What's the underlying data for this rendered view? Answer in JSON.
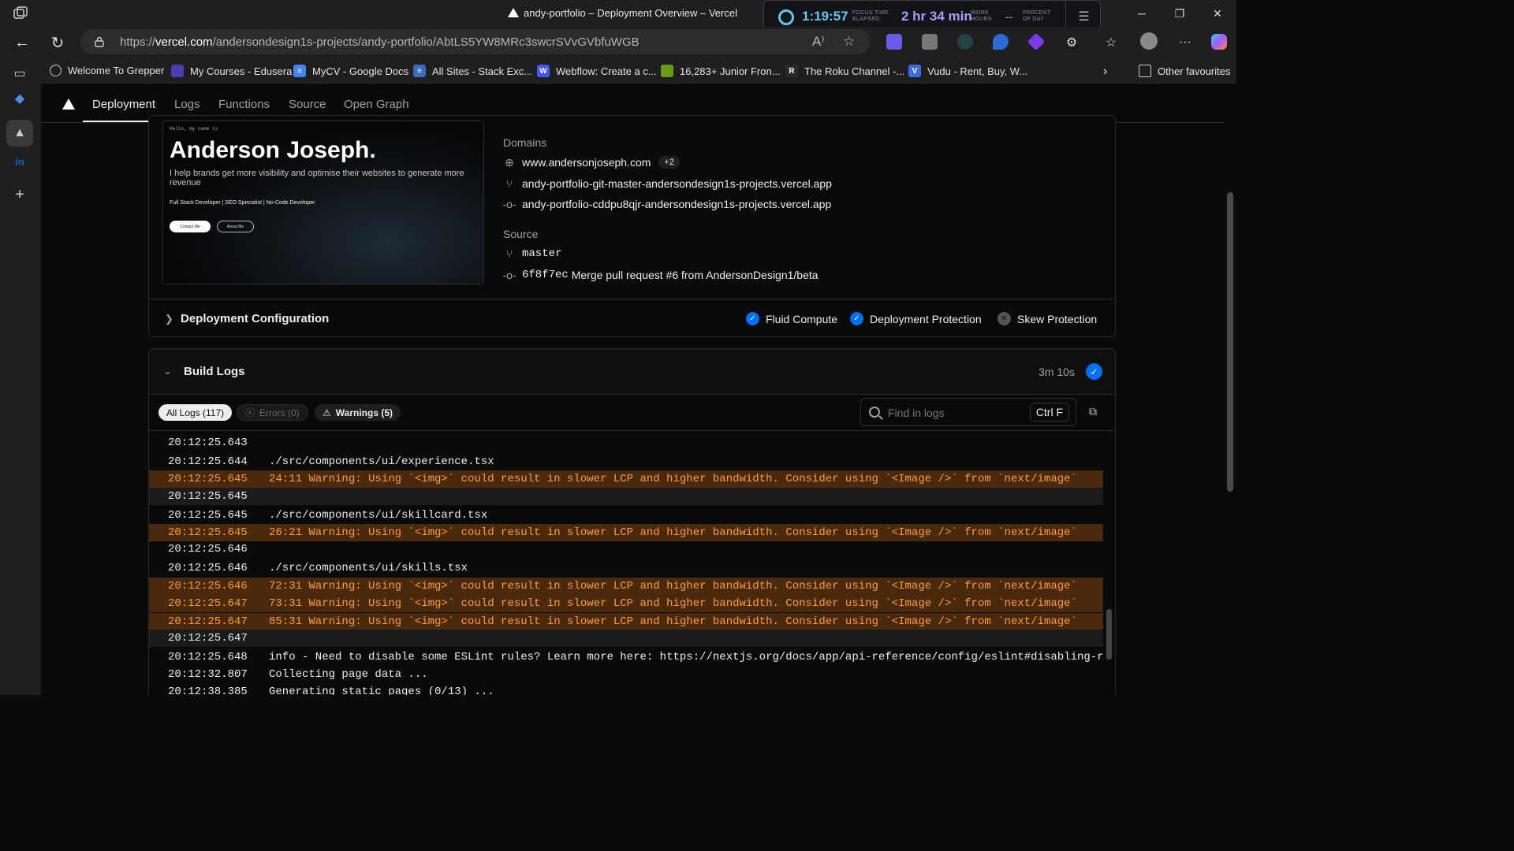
{
  "window": {
    "tab_title": "andy-portfolio – Deployment Overview – Vercel",
    "focus_timer": "1:19:57",
    "focus_label_1": "FOCUS TIME",
    "focus_label_2": "ELAPSED",
    "work_hours": "2 hr 34 min",
    "work_label_1": "WORK",
    "work_label_2": "HOURS",
    "percent_value": "--",
    "percent_label_1": "PERCENT",
    "percent_label_2": "OF DAY"
  },
  "addressbar": {
    "url_prefix": "https://",
    "url_host": "vercel.com",
    "url_path": "/andersondesign1s-projects/andy-portfolio/AbtLS5YW8MRc3swcrSVvGVbfuWGB"
  },
  "bookmarks": [
    {
      "label": "Welcome To Grepper",
      "icon": "globe-icon"
    },
    {
      "label": "My Courses - Edusera",
      "icon": "edusera-icon"
    },
    {
      "label": "MyCV - Google Docs",
      "icon": "google-docs-icon"
    },
    {
      "label": "All Sites - Stack Exc...",
      "icon": "stack-exchange-icon"
    },
    {
      "label": "Webflow: Create a c...",
      "icon": "webflow-icon"
    },
    {
      "label": "16,283+ Junior Fron...",
      "icon": "frontend-icon"
    },
    {
      "label": "The Roku Channel -...",
      "icon": "roku-icon"
    },
    {
      "label": "Vudu - Rent, Buy, W...",
      "icon": "vudu-icon"
    }
  ],
  "other_favourites": "Other favourites",
  "nav_tabs": [
    "Deployment",
    "Logs",
    "Functions",
    "Source",
    "Open Graph"
  ],
  "preview": {
    "hello": "Hello, my name is",
    "name": "Anderson Joseph.",
    "tagline": "I help brands get more visibility and optimise their websites to generate more revenue",
    "roles": "Full Stack Developer | SEO Specialist | No-Code Developer",
    "contact_btn": "Contact Me",
    "about_btn": "About Me"
  },
  "domains": {
    "label": "Domains",
    "primary": "www.andersonjoseph.com",
    "extra_count": "+2",
    "branch_url": "andy-portfolio-git-master-andersondesign1s-projects.vercel.app",
    "commit_url": "andy-portfolio-cddpu8qjr-andersondesign1s-projects.vercel.app"
  },
  "source": {
    "label": "Source",
    "branch": "master",
    "commit_sha": "6f8f7ec",
    "commit_message": "Merge pull request #6 from AndersonDesign1/beta"
  },
  "deployment_config": {
    "title": "Deployment Configuration",
    "features": [
      {
        "label": "Fluid Compute",
        "enabled": true
      },
      {
        "label": "Deployment Protection",
        "enabled": true
      },
      {
        "label": "Skew Protection",
        "enabled": false
      }
    ]
  },
  "build_logs": {
    "title": "Build Logs",
    "duration": "3m 10s",
    "filters": {
      "all": "All Logs (117)",
      "errors": "Errors (0)",
      "warnings": "Warnings (5)"
    },
    "search_placeholder": "Find in logs",
    "search_shortcut": "Ctrl F",
    "lines": [
      {
        "ts": "20:12:25.643",
        "msg": "",
        "kind": "plain"
      },
      {
        "ts": "20:12:25.644",
        "msg": "./src/components/ui/experience.tsx",
        "kind": "plain"
      },
      {
        "ts": "20:12:25.645",
        "msg": "24:11  Warning: Using `<img>` could result in slower LCP and higher bandwidth. Consider using `<Image />` from `next/image`",
        "kind": "warn"
      },
      {
        "ts": "20:12:25.645",
        "msg": "",
        "kind": "blank"
      },
      {
        "ts": "20:12:25.645",
        "msg": "./src/components/ui/skillcard.tsx",
        "kind": "plain"
      },
      {
        "ts": "20:12:25.645",
        "msg": "26:21  Warning: Using `<img>` could result in slower LCP and higher bandwidth. Consider using `<Image />` from `next/image`",
        "kind": "warn"
      },
      {
        "ts": "20:12:25.646",
        "msg": "",
        "kind": "plain"
      },
      {
        "ts": "20:12:25.646",
        "msg": "./src/components/ui/skills.tsx",
        "kind": "plain"
      },
      {
        "ts": "20:12:25.646",
        "msg": "72:31  Warning: Using `<img>` could result in slower LCP and higher bandwidth. Consider using `<Image />` from `next/image`",
        "kind": "warn"
      },
      {
        "ts": "20:12:25.647",
        "msg": "73:31  Warning: Using `<img>` could result in slower LCP and higher bandwidth. Consider using `<Image />` from `next/image`",
        "kind": "warn"
      },
      {
        "ts": "20:12:25.647",
        "msg": "85:31  Warning: Using `<img>` could result in slower LCP and higher bandwidth. Consider using `<Image />` from `next/image`",
        "kind": "warn"
      },
      {
        "ts": "20:12:25.647",
        "msg": "",
        "kind": "blank"
      },
      {
        "ts": "20:12:25.648",
        "msg": "info  - Need to disable some ESLint rules? Learn more here: https://nextjs.org/docs/app/api-reference/config/eslint#disabling-rules",
        "kind": "plain"
      },
      {
        "ts": "20:12:32.807",
        "msg": "   Collecting page data ...",
        "kind": "plain"
      },
      {
        "ts": "20:12:38.385",
        "msg": "   Generating static pages (0/13) ...",
        "kind": "plain"
      }
    ]
  },
  "colors": {
    "accent": "#0070f3",
    "warn_text": "#ff9a3c",
    "warn_bg": "#4a2a0c",
    "focus_cyan": "#5ec8f2"
  }
}
